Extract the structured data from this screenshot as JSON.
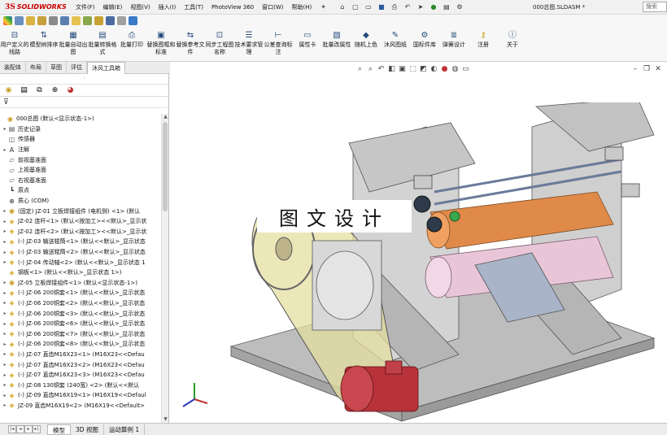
{
  "titlebar": {
    "logo_prefix": "3S",
    "logo_text": "SOLIDWORKS",
    "menus": [
      "文件(F)",
      "编辑(E)",
      "视图(V)",
      "插入(I)",
      "工具(T)",
      "PhotoView 360",
      "窗口(W)",
      "帮助(H)"
    ],
    "doc_title": "000总图.SLDASM *",
    "search_placeholder": "搜索"
  },
  "command_manager": {
    "buttons": [
      {
        "label": "用户定义的线路",
        "icon": "route-icon"
      },
      {
        "label": "模型树排序",
        "icon": "sort-tree-icon"
      },
      {
        "label": "批量自动出图",
        "icon": "auto-drawing-icon"
      },
      {
        "label": "批量转换格式",
        "icon": "convert-format-icon"
      },
      {
        "label": "批量打印",
        "icon": "print-icon"
      },
      {
        "label": "替换图框和标准",
        "icon": "replace-frame-icon"
      },
      {
        "label": "替换参考文件",
        "icon": "replace-reference-icon"
      },
      {
        "label": "同步工程图名称",
        "icon": "sync-name-icon"
      },
      {
        "label": "技术要求管理",
        "icon": "tech-req-icon"
      },
      {
        "label": "公差查询标注",
        "icon": "tolerance-icon"
      },
      {
        "label": "属性卡",
        "icon": "property-card-icon"
      },
      {
        "label": "批量改属性",
        "icon": "batch-property-icon"
      },
      {
        "label": "随机上色",
        "icon": "color-bucket-icon"
      },
      {
        "label": "沐风图纸",
        "icon": "drawing-icon"
      },
      {
        "label": "国标件库",
        "icon": "standard-parts-icon"
      },
      {
        "label": "弹簧设计",
        "icon": "spring-icon"
      },
      {
        "label": "注册",
        "icon": "key-icon"
      },
      {
        "label": "关于",
        "icon": "info-icon"
      }
    ],
    "tabs": [
      "装配体",
      "布局",
      "草图",
      "评估",
      "沐风工具箱"
    ],
    "active_tab": 4
  },
  "feature_tree": {
    "items": [
      {
        "text": "000总图  (默认<显示状态-1>)",
        "icon": "assembly-icon",
        "expander": ""
      },
      {
        "text": "历史记录",
        "icon": "history-icon",
        "expander": "▸"
      },
      {
        "text": "传感器",
        "icon": "sensor-icon",
        "expander": ""
      },
      {
        "text": "注解",
        "icon": "annotation-icon",
        "expander": "▸"
      },
      {
        "text": "前视基准面",
        "icon": "plane-icon",
        "expander": ""
      },
      {
        "text": "上视基准面",
        "icon": "plane-icon",
        "expander": ""
      },
      {
        "text": "右视基准面",
        "icon": "plane-icon",
        "expander": ""
      },
      {
        "text": "原点",
        "icon": "origin-icon",
        "expander": ""
      },
      {
        "text": "质心 (COM)",
        "icon": "com-icon",
        "expander": ""
      },
      {
        "text": "(固定) JZ-01 立板焊接组件 (电机侧) <1> (默认",
        "icon": "subassembly-icon",
        "expander": "▸"
      },
      {
        "text": "JZ-02 连杆<1> (默认<按加工><<默认>_显示状",
        "icon": "part-icon",
        "expander": "▸"
      },
      {
        "text": "JZ-02 连杆<2> (默认<按加工><<默认>_显示状",
        "icon": "part-icon",
        "expander": "▸"
      },
      {
        "text": "(-) JZ-03 输送辊筒<1> (默认<<默认>_显示状态",
        "icon": "part-icon",
        "expander": "▸"
      },
      {
        "text": "(-) JZ-03 输送辊筒<2> (默认<<默认>_显示状态",
        "icon": "part-icon",
        "expander": "▸"
      },
      {
        "text": "(-) JZ-04 传动轴<2> (默认<<默认>_显示状态 1",
        "icon": "part-icon",
        "expander": "▸"
      },
      {
        "text": "钢板<1> (默认<<默认>_显示状态 1>)",
        "icon": "part-icon",
        "expander": ""
      },
      {
        "text": "JZ-05 立板焊接组件<1> (默认<显示状态-1>)",
        "icon": "subassembly-icon",
        "expander": "▸"
      },
      {
        "text": "(-) JZ-06  200铜套<1> (默认<<默认>_显示状态",
        "icon": "part-icon",
        "expander": "▸"
      },
      {
        "text": "(-) JZ-06  200铜套<2> (默认<<默认>_显示状态",
        "icon": "part-icon",
        "expander": "▸"
      },
      {
        "text": "(-) JZ-06  200铜套<3> (默认<<默认>_显示状态",
        "icon": "part-icon",
        "expander": "▸"
      },
      {
        "text": "(-) JZ-06  200铜套<6> (默认<<默认>_显示状态",
        "icon": "part-icon",
        "expander": "▸"
      },
      {
        "text": "(-) JZ-06  200铜套<7> (默认<<默认>_显示状态",
        "icon": "part-icon",
        "expander": "▸"
      },
      {
        "text": "(-) JZ-06  200铜套<8> (默认<<默认>_显示状态",
        "icon": "part-icon",
        "expander": "▸"
      },
      {
        "text": "(-) JZ-07 直齿M16X23<1> (M16X23<<Defau",
        "icon": "part-icon",
        "expander": "▸"
      },
      {
        "text": "(-) JZ-07 直齿M16X23<2> (M16X23<<Defau",
        "icon": "part-icon",
        "expander": "▸"
      },
      {
        "text": "(-) JZ-07 直齿M16X23<3> (M16X23<<Defau",
        "icon": "part-icon",
        "expander": "▸"
      },
      {
        "text": "(-) JZ-08  130铜套 (240宽) <2> (默认<<默认",
        "icon": "part-icon",
        "expander": "▸"
      },
      {
        "text": "(-) JZ-09 直齿M16X19<1> (M16X19<<Defaul",
        "icon": "part-icon",
        "expander": "▸"
      },
      {
        "text": "JZ-09 直齿M16X19<2> (M16X19<<Default>",
        "icon": "part-icon",
        "expander": "▸"
      }
    ]
  },
  "viewport": {
    "watermark": "图文设计"
  },
  "bottom_tabs": {
    "tabs": [
      "模型",
      "3D 视图",
      "运动算例 1"
    ],
    "active": 0
  },
  "colors": {
    "logo_red": "#cc0000",
    "motor_red": "#b8323a",
    "roller_orange": "#e08a4a",
    "roller_pink": "#e8c6d8",
    "frame_gray": "#b9b9b9",
    "guard_yellow": "#e6dfa0"
  }
}
